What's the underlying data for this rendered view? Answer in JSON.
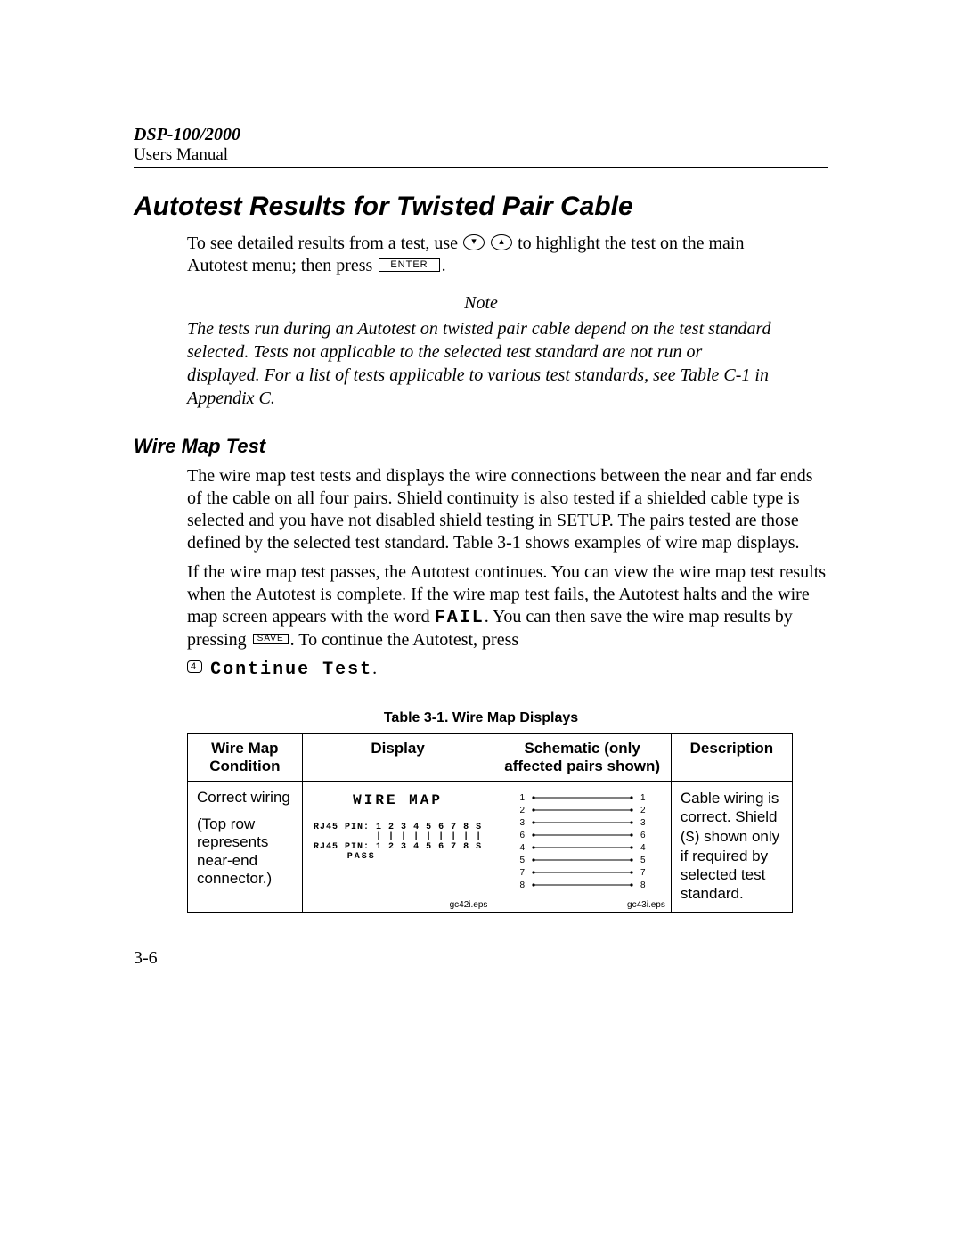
{
  "header": {
    "product": "DSP-100/2000",
    "subtitle": "Users Manual"
  },
  "section_title": "Autotest Results for Twisted Pair Cable",
  "intro": {
    "line1_pre": "To see detailed results from a test, use ",
    "line1_post": " to highlight the test on the main",
    "line2_pre": "Autotest menu; then press ",
    "enter_key": "ENTER",
    "period": "."
  },
  "arrows": {
    "down": "▾",
    "up": "▴"
  },
  "note": {
    "label": "Note",
    "body": "The tests run during an Autotest on twisted pair cable depend on the test standard selected. Tests not applicable to the selected test standard are not run or displayed. For a list of tests applicable to various test standards, see Table C-1 in Appendix C."
  },
  "subsection_title": "Wire Map Test",
  "para1": "The wire map test tests and displays the wire connections between the near and far ends of the cable on all four pairs. Shield continuity is also tested if a shielded cable type is selected and you have not disabled shield testing in SETUP. The pairs tested are those defined by the selected test standard. Table 3-1 shows examples of wire map displays.",
  "para2": {
    "seg1": "If the wire map test passes, the Autotest continues. You can view the wire map test results when the Autotest is complete. If the wire map test fails, the Autotest halts and the wire map screen appears with the word ",
    "fail": "FAIL",
    "seg2": ". You can then save the wire map results by pressing ",
    "save_key": "SAVE",
    "seg3": ". To continue the Autotest, press"
  },
  "continue": {
    "softkey_num": "4",
    "label": "Continue Test",
    "period": "."
  },
  "table": {
    "caption": "Table 3-1. Wire Map Displays",
    "headers": {
      "c1": "Wire Map Condition",
      "c2": "Display",
      "c3": "Schematic (only affected pairs shown)",
      "c4": "Description"
    },
    "row1": {
      "condition_main": "Correct wiring",
      "condition_note": "(Top row represents near-end connector.)",
      "display_title": "WIRE MAP",
      "display_line1": "RJ45 PIN: 1 2 3 4 5 6 7 8 S",
      "display_bars": "          | | | | | | | | |",
      "display_line2": "RJ45 PIN: 1 2 3 4 5 6 7 8 S",
      "display_pass": "PASS",
      "display_eps": "gc42i.eps",
      "schematic_pins": [
        "1",
        "2",
        "3",
        "6",
        "4",
        "5",
        "7",
        "8"
      ],
      "schematic_eps": "gc43i.eps",
      "desc_pre": "Cable wiring is correct. Shield (",
      "desc_s": "S",
      "desc_post": ") shown only if required by selected test standard."
    }
  },
  "page_number": "3-6"
}
